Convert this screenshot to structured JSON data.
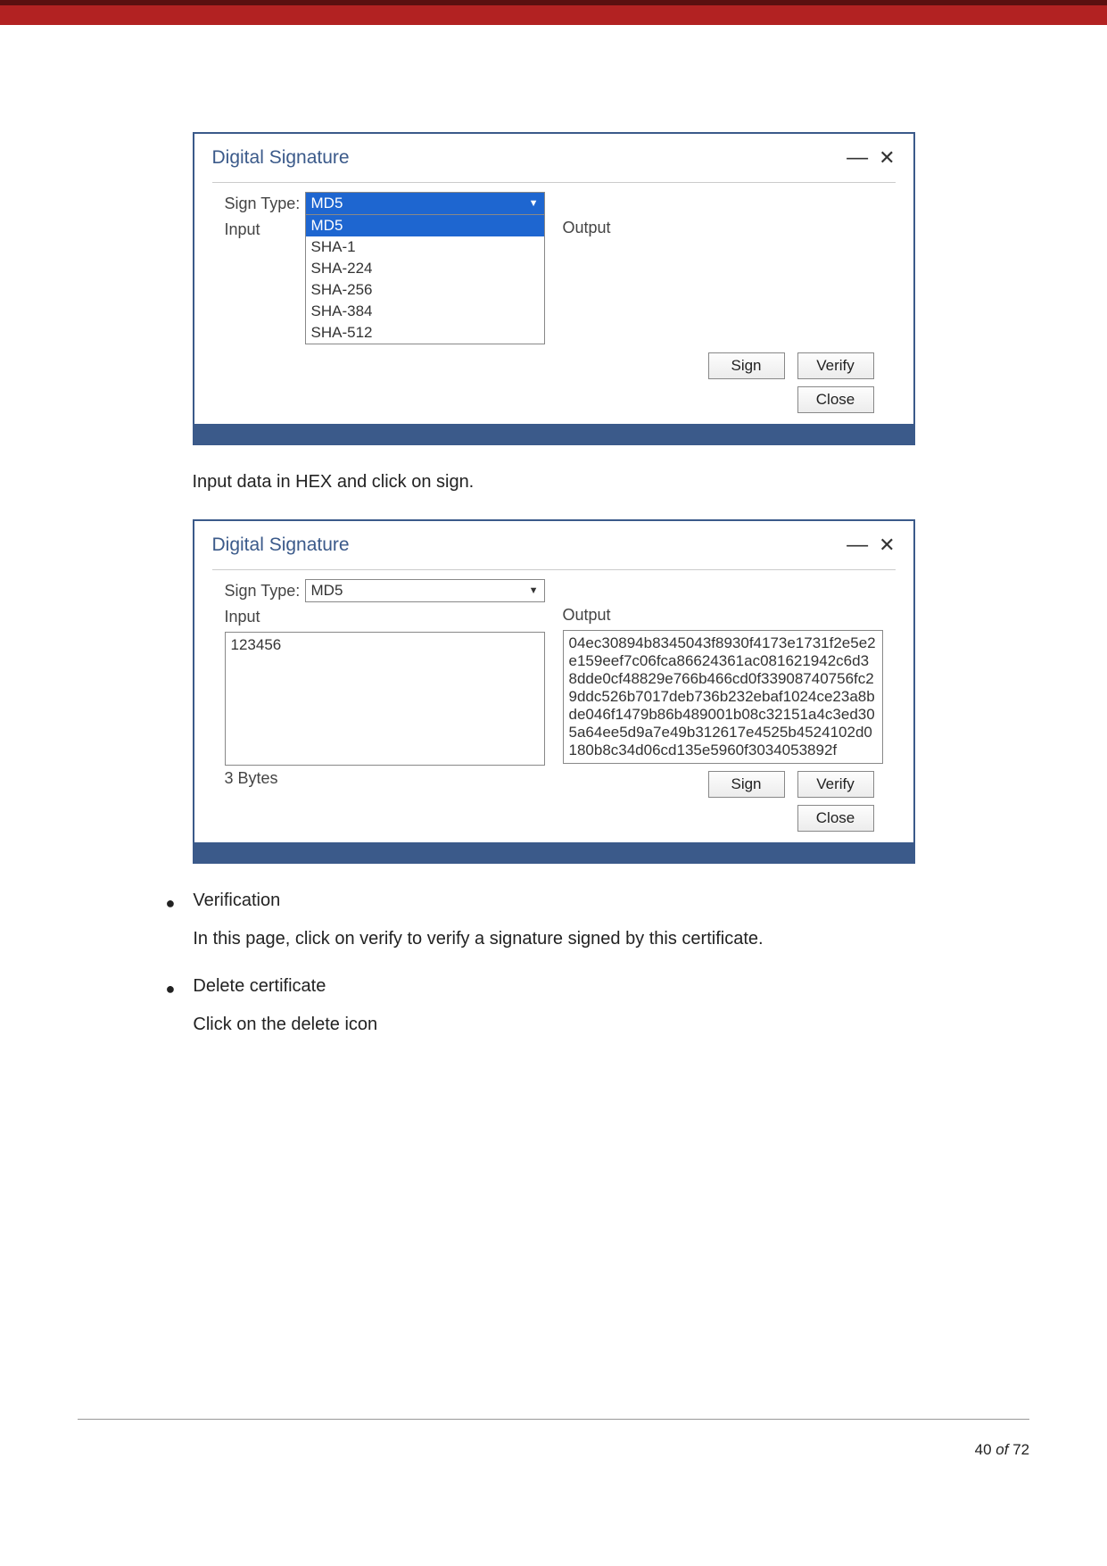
{
  "dialog1": {
    "title": "Digital Signature",
    "signTypeLabel": "Sign Type:",
    "signTypeValue": "MD5",
    "inputLabel": "Input",
    "outputLabel": "Output",
    "options": [
      "MD5",
      "SHA-1",
      "SHA-224",
      "SHA-256",
      "SHA-384",
      "SHA-512"
    ],
    "signBtn": "Sign",
    "verifyBtn": "Verify",
    "closeBtn": "Close"
  },
  "instr1": "Input data in HEX and click on sign.",
  "dialog2": {
    "title": "Digital Signature",
    "signTypeLabel": "Sign Type:",
    "signTypeValue": "MD5",
    "inputLabel": "Input",
    "inputValue": "123456",
    "outputLabel": "Output",
    "outputValue": "04ec30894b8345043f8930f4173e1731f2e5e2e159eef7c06fca86624361ac081621942c6d38dde0cf48829e766b466cd0f33908740756fc29ddc526b7017deb736b232ebaf1024ce23a8bde046f1479b86b489001b08c32151a4c3ed305a64ee5d9a7e49b312617e4525b4524102d0180b8c34d06cd135e5960f3034053892f",
    "bytes": "3 Bytes",
    "signBtn": "Sign",
    "verifyBtn": "Verify",
    "closeBtn": "Close"
  },
  "bullets": {
    "verification": {
      "title": "Verification",
      "body": "In this page, click on verify to verify a signature signed by this certificate."
    },
    "delete": {
      "title": "Delete certificate",
      "body": "Click on the delete icon"
    }
  },
  "footer": {
    "page": "40",
    "of": "of",
    "total": "72"
  }
}
